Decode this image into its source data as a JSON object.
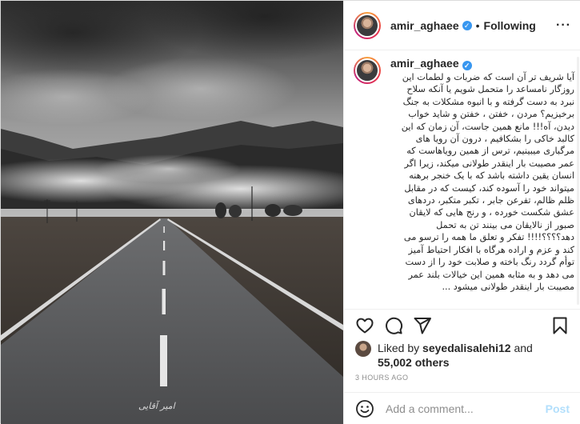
{
  "post": {
    "username": "amir_aghaee",
    "follow_status": "Following",
    "separator": "•",
    "more_icon": "more-options-icon",
    "photo_signature": "امیر آقایی"
  },
  "caption": {
    "username": "amir_aghaee",
    "text": "آیا شریف تر آن است که ضربات و لطمات این روزگار نامساعد را متحمل شویم یا آنکه سلاح نبرد به دست گرفته و با انبوه مشکلات به جنگ برخیزیم؟ مردن ، خفتن ، خفتن و شاید خواب دیدن، آه!!! مانع همین جاست، آن زمان که این کالبد خاکی را بشکافیم ، درون آن رویا های مرگباری میبینیم، ترس از همین رویاهاست که عمر مصیبت بار اینقدر طولانی میکند، زیرا اگر انسان یقین داشته باشد که با یک خنجر برهنه میتواند خود را آسوده کند، کیست که در مقابل ظلم ظالم، تفرعن جابر ، تکبر متکبر، دردهای عشق شکست خورده ، و رنج هایی که لایقان صبور از نالایقان می بینند تن به تحمل دهد؟؟؟؟!!!! تفکر و تعلق ما همه را ترسو می کند و عزم و اراده هرگاه با افکار احتیاط آمیز توأم گردد رنگ باخته و صلابت خود را از دست می دهد و به مثابه همین این خیالات بلند عمر مصیبت بار اینقدر طولانی میشود ..."
  },
  "likes": {
    "prefix": "Liked by",
    "liker": "seyedalisalehi12",
    "joiner": "and",
    "count": "55,002 others"
  },
  "timestamp": "3 HOURS AGO",
  "comment_box": {
    "placeholder": "Add a comment...",
    "post_label": "Post"
  },
  "colors": {
    "verified_badge": "#3897f0",
    "post_button_disabled": "#b2dffc",
    "secondary_text": "#8e8e8e"
  },
  "icons": [
    "heart-icon",
    "comment-icon",
    "share-icon",
    "bookmark-icon",
    "emoji-icon",
    "verified-badge-icon"
  ]
}
